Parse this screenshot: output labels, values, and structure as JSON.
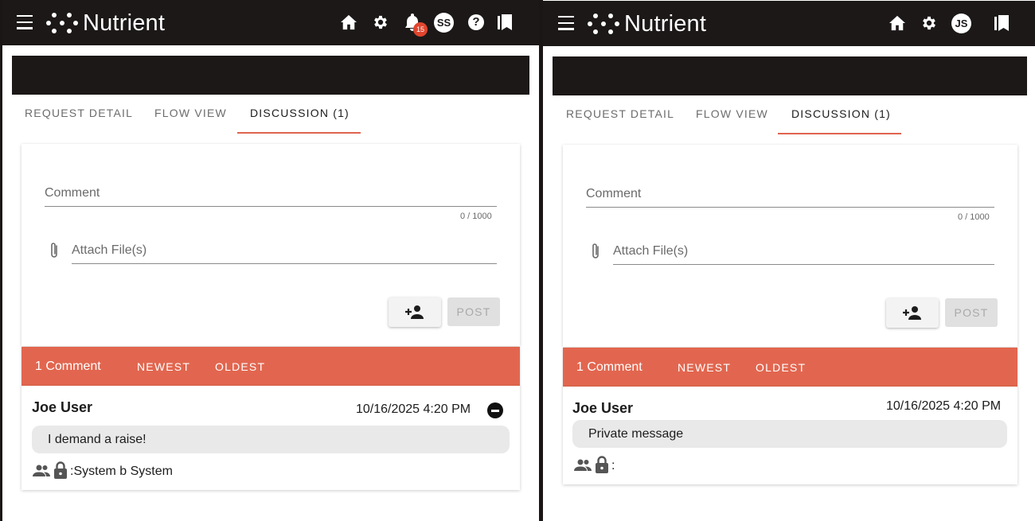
{
  "app": {
    "name": "Nutrient"
  },
  "left": {
    "user_initials": "SS",
    "notification_count": "15",
    "help_label": "?",
    "tabs": [
      {
        "label": "REQUEST DETAIL"
      },
      {
        "label": "FLOW VIEW"
      },
      {
        "label": "DISCUSSION (1)"
      }
    ],
    "form": {
      "comment_placeholder": "Comment",
      "counter": "0 / 1000",
      "attach_placeholder": "Attach File(s)",
      "post_label": "POST"
    },
    "sort": {
      "count_label": "1 Comment",
      "newest_label": "NEWEST",
      "oldest_label": "OLDEST"
    },
    "comments": [
      {
        "author": "Joe User",
        "date": "10/16/2025 4:20 PM",
        "text": "I demand a raise!",
        "visibility": ":System b System"
      }
    ]
  },
  "right": {
    "user_initials": "JS",
    "tabs": [
      {
        "label": "REQUEST DETAIL"
      },
      {
        "label": "FLOW VIEW"
      },
      {
        "label": "DISCUSSION (1)"
      }
    ],
    "form": {
      "comment_placeholder": "Comment",
      "counter": "0 / 1000",
      "attach_placeholder": "Attach File(s)",
      "post_label": "POST"
    },
    "sort": {
      "count_label": "1 Comment",
      "newest_label": "NEWEST",
      "oldest_label": "OLDEST"
    },
    "comments": [
      {
        "author": "Joe User",
        "date": "10/16/2025 4:20 PM",
        "text": "Private message",
        "visibility": ":"
      }
    ]
  },
  "colors": {
    "topbar": "#1c1818",
    "accent": "#e2664f",
    "tab_underline": "#e0644f",
    "badge": "#e0452e"
  },
  "icons": [
    "menu-icon",
    "nutrient-logo",
    "home-icon",
    "gear-icon",
    "bell-icon",
    "help-icon",
    "bookmark-icon",
    "paperclip-icon",
    "person-add-icon",
    "remove-circle-icon",
    "group-icon",
    "lock-icon"
  ]
}
